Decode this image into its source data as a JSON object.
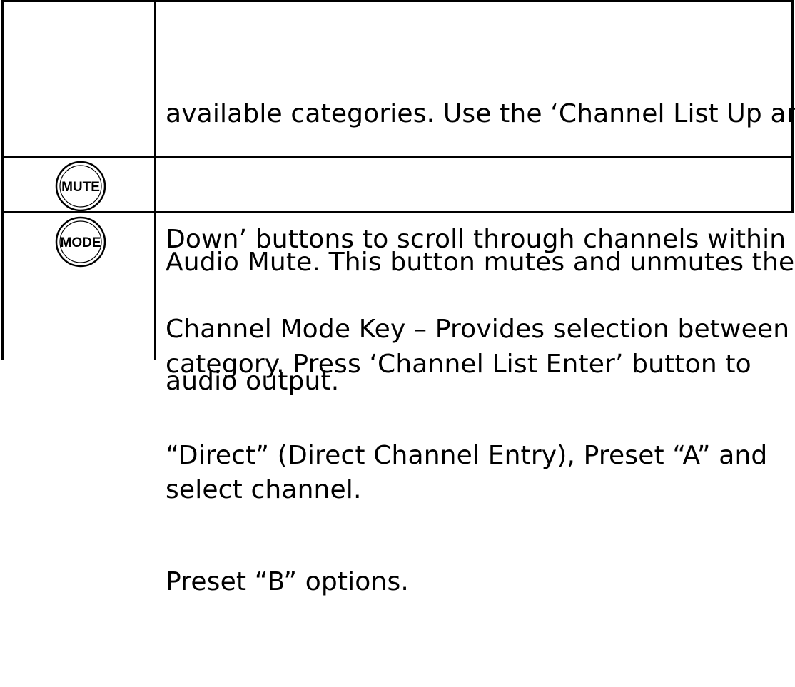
{
  "rows": [
    {
      "icon": null,
      "lines": [
        "available categories. Use the ‘Channel List Up and",
        "Down’ buttons to scroll through channels within a",
        "category. Press ‘Channel List Enter’ button to",
        "select channel."
      ]
    },
    {
      "icon": "mute-button-icon",
      "icon_label": "MUTE",
      "lines": [
        "Audio Mute. This button mutes and unmutes the",
        "audio output."
      ]
    },
    {
      "icon": "mode-button-icon",
      "icon_label": "MODE",
      "lines": [
        "Channel Mode Key – Provides selection between",
        "“Direct” (Direct Channel Entry), Preset “A” and",
        "Preset “B” options."
      ]
    }
  ]
}
